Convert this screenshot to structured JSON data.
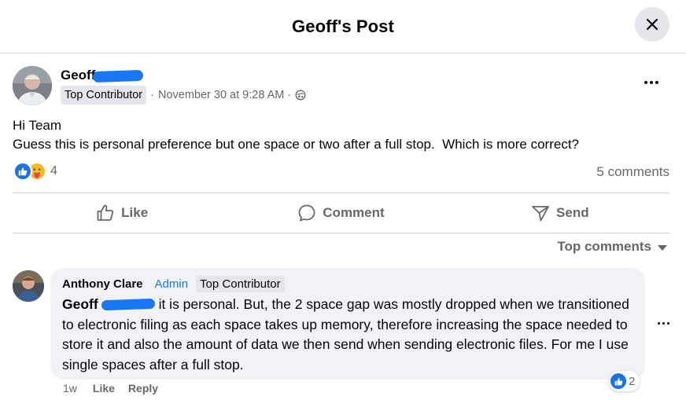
{
  "header": {
    "title": "Geoff's Post"
  },
  "post": {
    "author": "Geoff",
    "badge": "Top Contributor",
    "separator": "·",
    "timestamp": "November 30 at 9:28 AM",
    "separator2": "·",
    "audience_icon": "globe-icon",
    "body": "Hi Team\nGuess this is personal preference but one space or two after a full stop.  Which is more correct?",
    "reaction_count": "4",
    "comments_label": "5 comments"
  },
  "actions": {
    "like": "Like",
    "comment": "Comment",
    "send": "Send"
  },
  "sort": {
    "label": "Top comments"
  },
  "comment": {
    "author": "Anthony Clare",
    "role": "Admin",
    "badge": "Top Contributor",
    "mention": "Geoff",
    "text": " it is personal. But, the 2 space gap was mostly dropped when we transitioned to electronic filing as each space takes up memory, therefore increasing the space needed to store it and also the amount of data we then send when sending electronic files. For me I use single spaces after a full stop.",
    "time": "1w",
    "like": "Like",
    "reply": "Reply",
    "reaction_count": "2"
  },
  "colors": {
    "accent": "#1877f2",
    "secondary_text": "#65676b",
    "bubble": "#f0f2f5"
  }
}
